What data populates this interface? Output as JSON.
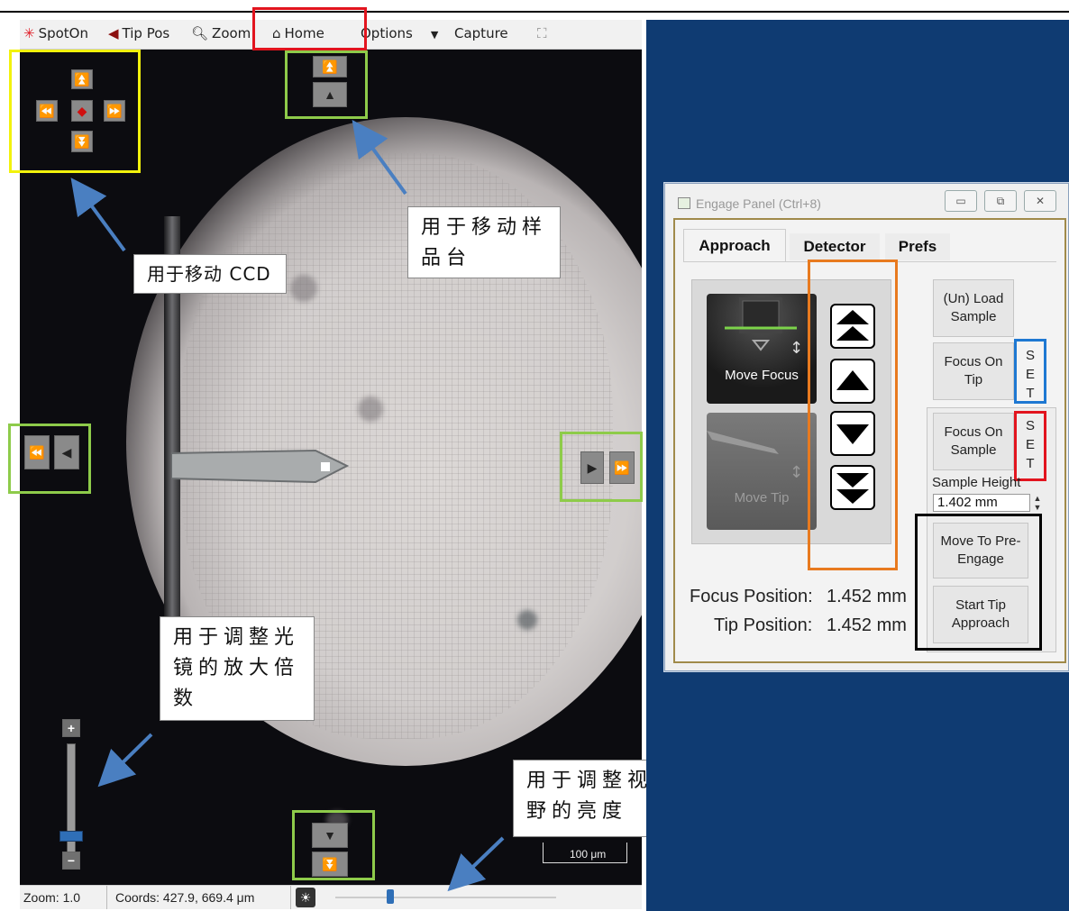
{
  "toolbar": {
    "spoton": "SpotOn",
    "tippos": "Tip Pos",
    "zoom": "Zoom",
    "home": "Home",
    "options": "Options",
    "capture": "Capture"
  },
  "callouts": {
    "move_ccd": "用于移动 CCD",
    "move_stage": "用于移动样品台",
    "adjust_mag": "用于调整光镜的放大倍数",
    "adjust_brightness": "用于调整视野的亮度"
  },
  "scalebar": "100 μm",
  "status": {
    "zoom": "Zoom: 1.0",
    "coords": "Coords: 427.9, 669.4 μm"
  },
  "engage_panel": {
    "title": "Engage Panel (Ctrl+8)",
    "tabs": [
      "Approach",
      "Detector",
      "Prefs"
    ],
    "move_focus": "Move Focus",
    "move_tip": "Move Tip",
    "unload_sample": "(Un) Load Sample",
    "focus_on_tip": "Focus On Tip",
    "focus_on_sample": "Focus On Sample",
    "set_label": "S E T",
    "sample_height_label": "Sample Height",
    "sample_height_value": "1.402 mm",
    "move_to_preengage": "Move To Pre-Engage",
    "start_tip_approach": "Start Tip Approach",
    "focus_position_label": "Focus Position:",
    "focus_position_value": "1.452 mm",
    "tip_position_label": "Tip Position:",
    "tip_position_value": "1.452 mm"
  },
  "colors": {
    "highlight_yellow": "#f2f20c",
    "highlight_green": "#8ecb4a",
    "highlight_red": "#e2141e",
    "highlight_blue": "#1e78d2",
    "highlight_orange": "#e87a1f",
    "annotation_arrow": "#4a7fc1",
    "background_blue": "#0f3b72"
  },
  "brightness_level": 0.25,
  "magnification_level": 0.15
}
